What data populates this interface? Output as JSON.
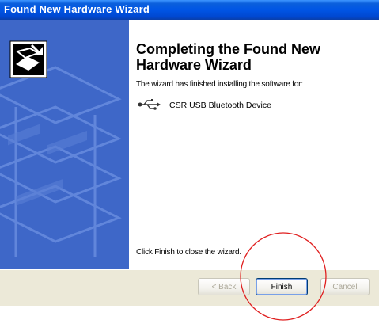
{
  "window": {
    "title": "Found New Hardware Wizard"
  },
  "main": {
    "heading": "Completing the Found New Hardware Wizard",
    "description": "The wizard has finished installing the software for:",
    "device": {
      "name": "CSR USB Bluetooth Device",
      "icon": "usb-icon"
    },
    "finish_hint": "Click Finish to close the wizard."
  },
  "buttons": {
    "back": "< Back",
    "finish": "Finish",
    "cancel": "Cancel"
  },
  "colors": {
    "titlebar": "#0055e5",
    "side_panel": "#3e67c8",
    "highlight_circle": "#e02020"
  }
}
